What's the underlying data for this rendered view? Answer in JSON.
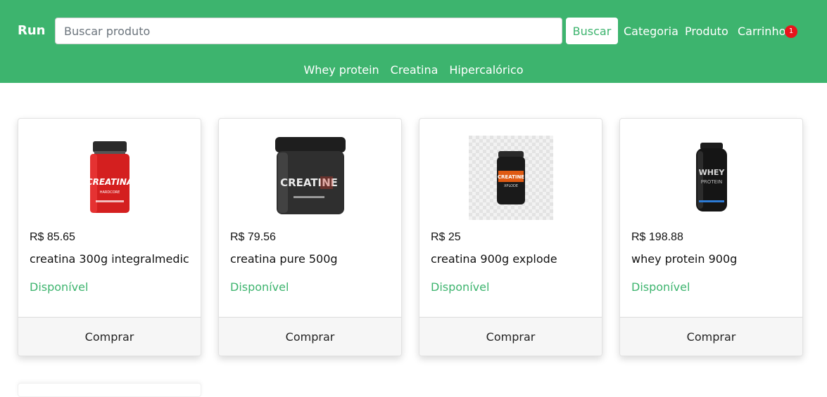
{
  "navbar": {
    "brand": "Run",
    "search": {
      "placeholder": "Buscar produto",
      "value": ""
    },
    "search_button": "Buscar",
    "links": [
      "Categoria",
      "Produto",
      "Carrinho"
    ],
    "cart_count": "1",
    "subnav": [
      "Whey protein",
      "Creatina",
      "Hipercalórico"
    ]
  },
  "products": [
    {
      "price": "R$ 85.65",
      "name": "creatina 300g integralmedic",
      "status": "Disponível",
      "buy": "Comprar",
      "image": "creatina-hardcore-jar"
    },
    {
      "price": "R$ 79.56",
      "name": "creatina pure 500g",
      "status": "Disponível",
      "buy": "Comprar",
      "image": "creatine-black-jar"
    },
    {
      "price": "R$ 25",
      "name": "creatina 900g explode",
      "status": "Disponível",
      "buy": "Comprar",
      "image": "creatine-xplode-jar"
    },
    {
      "price": "R$ 198.88",
      "name": "whey protein 900g",
      "status": "Disponível",
      "buy": "Comprar",
      "image": "whey-protein-jar"
    }
  ],
  "colors": {
    "primary": "#3db46e",
    "badge": "#e8141c"
  }
}
